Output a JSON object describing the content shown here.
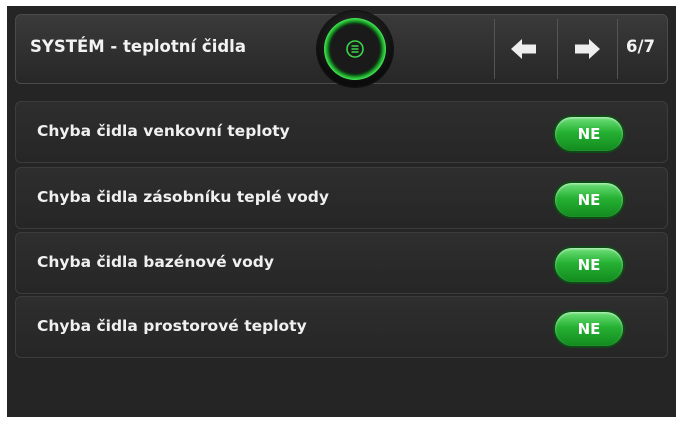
{
  "header": {
    "title": "SYSTÉM - teplotní čidla",
    "page": "6/7",
    "menu_icon": "menu-icon",
    "back_icon": "arrow-left-icon",
    "forward_icon": "arrow-right-icon"
  },
  "colors": {
    "background": "#252525",
    "toggle_green": "#26b133",
    "text": "#f0f0f0"
  },
  "rows": [
    {
      "label": "Chyba čidla venkovní teploty",
      "value": "NE"
    },
    {
      "label": "Chyba čidla zásobníku teplé vody",
      "value": "NE"
    },
    {
      "label": "Chyba čidla bazénové vody",
      "value": "NE"
    },
    {
      "label": "Chyba čidla prostorové teploty",
      "value": "NE"
    }
  ]
}
